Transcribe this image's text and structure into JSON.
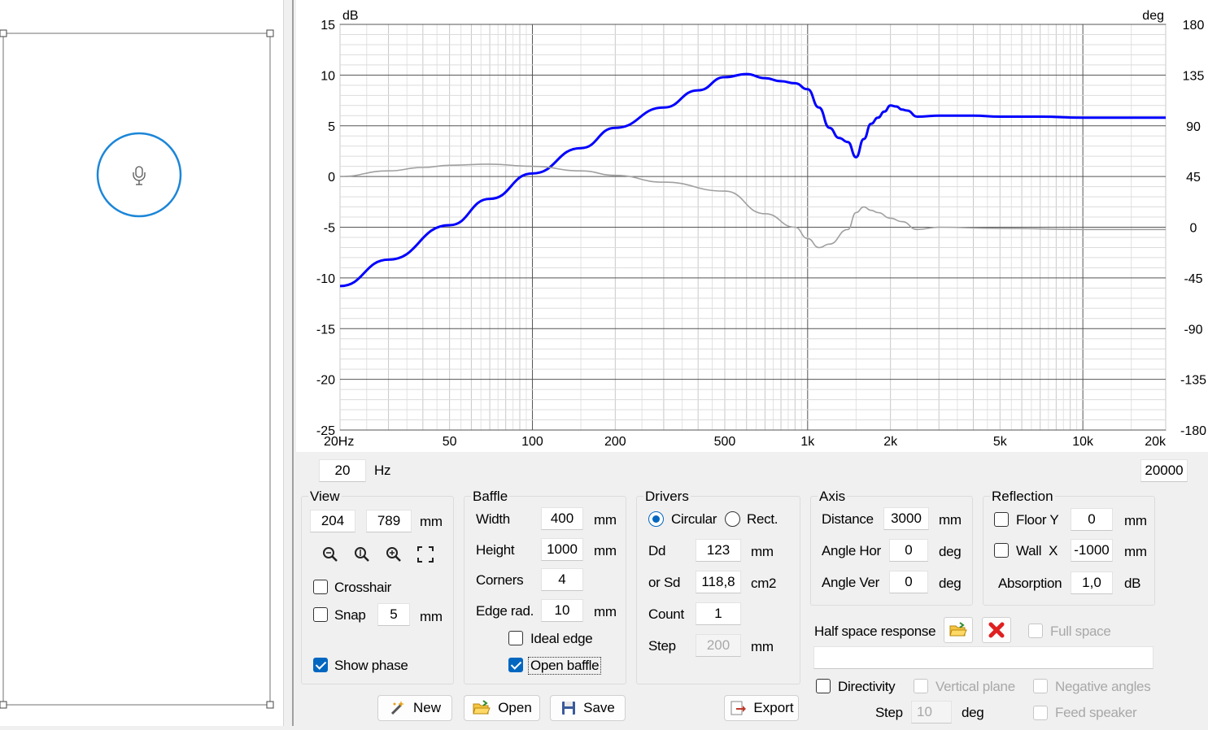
{
  "chart_data": {
    "type": "line",
    "xscale": "log",
    "xlim": [
      20,
      20000
    ],
    "ylim": [
      -25,
      15
    ],
    "y2lim": [
      -180,
      180
    ],
    "grid": true,
    "left_unit": "dB",
    "right_unit": "deg",
    "xticks": [
      {
        "v": 20,
        "label": "20Hz"
      },
      {
        "v": 50,
        "label": "50"
      },
      {
        "v": 100,
        "label": "100"
      },
      {
        "v": 200,
        "label": "200"
      },
      {
        "v": 500,
        "label": "500"
      },
      {
        "v": 1000,
        "label": "1k"
      },
      {
        "v": 2000,
        "label": "2k"
      },
      {
        "v": 5000,
        "label": "5k"
      },
      {
        "v": 10000,
        "label": "10k"
      },
      {
        "v": 20000,
        "label": "20k"
      }
    ],
    "yticks": [
      "15",
      "10",
      "5",
      "0",
      "-5",
      "-10",
      "-15",
      "-20",
      "-25"
    ],
    "y2ticks": [
      "180",
      "135",
      "90",
      "45",
      "0",
      "-45",
      "-90",
      "-135",
      "-180"
    ],
    "series": [
      {
        "color": "#0000ff",
        "axis": "left",
        "x": [
          20,
          30,
          50,
          70,
          100,
          150,
          200,
          300,
          400,
          500,
          600,
          700,
          800,
          900,
          1000,
          1100,
          1200,
          1300,
          1400,
          1500,
          1600,
          1700,
          1800,
          1900,
          2000,
          2100,
          2200,
          2300,
          2500,
          3000,
          4000,
          5000,
          7000,
          10000,
          20000
        ],
        "y": [
          -10.8,
          -8.2,
          -4.8,
          -2.2,
          0.3,
          2.8,
          4.8,
          6.8,
          8.5,
          9.8,
          10.1,
          9.7,
          9.4,
          9.2,
          8.6,
          6.8,
          4.8,
          3.8,
          3.4,
          1.9,
          3.7,
          5.2,
          5.8,
          6.4,
          7.0,
          6.9,
          6.6,
          6.5,
          5.9,
          6.0,
          6.0,
          5.9,
          5.9,
          5.8,
          5.8
        ]
      },
      {
        "color": "#a0a0a0",
        "axis": "right",
        "x": [
          20,
          30,
          40,
          50,
          70,
          100,
          150,
          200,
          300,
          500,
          700,
          900,
          1000,
          1100,
          1200,
          1400,
          1500,
          1600,
          1700,
          1800,
          2000,
          2200,
          2500,
          3000,
          5000,
          10000,
          20000
        ],
        "y": [
          45,
          50,
          53,
          55,
          56,
          54,
          50,
          46,
          40,
          32,
          12,
          0,
          -10,
          -18,
          -15,
          -2,
          13,
          18,
          15,
          13,
          8,
          5,
          -2,
          0,
          -1,
          -2,
          -2
        ]
      }
    ]
  },
  "freq_min": "20",
  "freq_min_unit": "Hz",
  "freq_max": "20000",
  "view": {
    "title": "View",
    "x": "204",
    "y": "789",
    "unit": "mm",
    "crosshair_label": "Crosshair",
    "crosshair_checked": false,
    "snap_label": "Snap",
    "snap_value": "5",
    "snap_unit": "mm",
    "show_phase_label": "Show phase",
    "show_phase_checked": true
  },
  "baffle": {
    "title": "Baffle",
    "width_label": "Width",
    "width": "400",
    "width_unit": "mm",
    "height_label": "Height",
    "height": "1000",
    "height_unit": "mm",
    "corners_label": "Corners",
    "corners": "4",
    "edge_label": "Edge rad.",
    "edge": "10",
    "edge_unit": "mm",
    "ideal_edge_label": "Ideal edge",
    "open_baffle_label": "Open baffle"
  },
  "drivers": {
    "title": "Drivers",
    "circular_label": "Circular",
    "rect_label": "Rect.",
    "dd_label": "Dd",
    "dd": "123",
    "dd_unit": "mm",
    "sd_label": "or Sd",
    "sd": "118,8",
    "sd_unit": "cm2",
    "count_label": "Count",
    "count": "1",
    "step_label": "Step",
    "step": "200",
    "step_unit": "mm"
  },
  "axis": {
    "title": "Axis",
    "distance_label": "Distance",
    "distance": "3000",
    "distance_unit": "mm",
    "angle_hor_label": "Angle Hor",
    "angle_hor": "0",
    "angle_hor_unit": "deg",
    "angle_ver_label": "Angle Ver",
    "angle_ver": "0",
    "angle_ver_unit": "deg"
  },
  "reflection": {
    "title": "Reflection",
    "floor_label": "Floor Y",
    "floor": "0",
    "floor_unit": "mm",
    "wall_label": "Wall  X",
    "wall": "-1000",
    "wall_unit": "mm",
    "absorption_label": "Absorption",
    "absorption": "1,0",
    "absorption_unit": "dB"
  },
  "half_space": {
    "label": "Half space response",
    "full_space_label": "Full space",
    "file_value": ""
  },
  "directivity": {
    "label": "Directivity",
    "vertical_plane_label": "Vertical plane",
    "negative_angles_label": "Negative angles",
    "step_label": "Step",
    "step": "10",
    "step_unit": "deg",
    "feed_speaker_label": "Feed speaker"
  },
  "buttons": {
    "new": "New",
    "open": "Open",
    "save": "Save",
    "export": "Export"
  }
}
